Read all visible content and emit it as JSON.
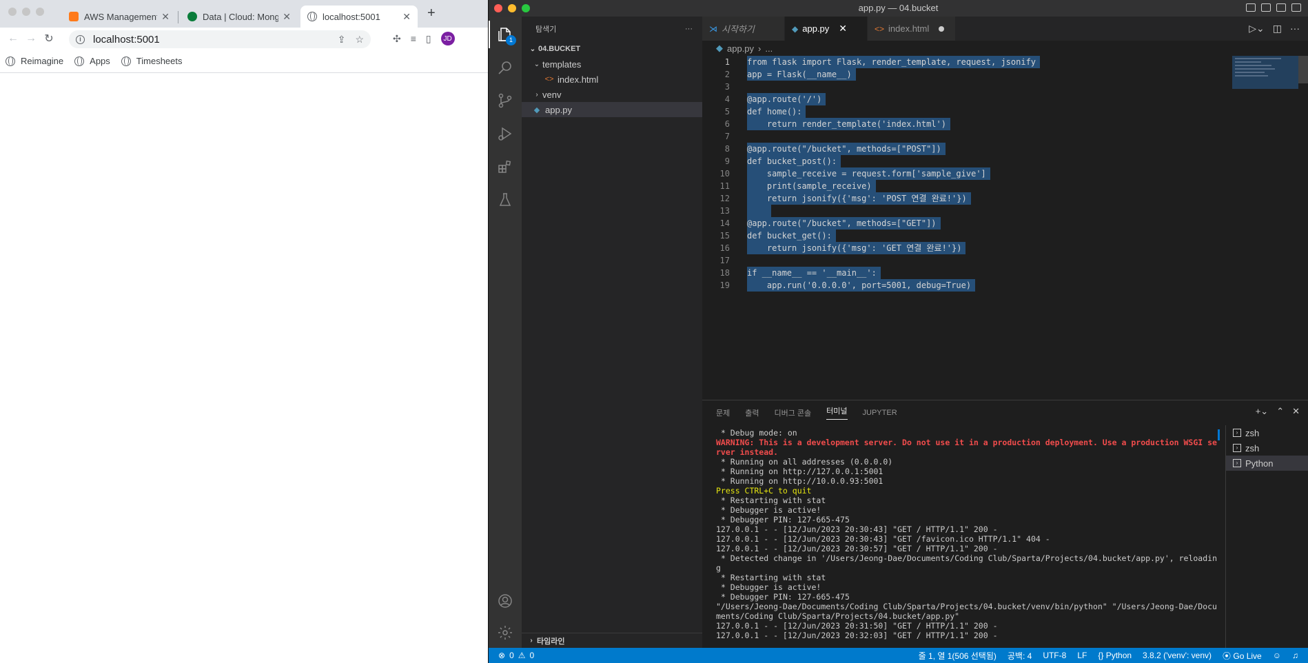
{
  "browser": {
    "tabs": [
      {
        "title": "AWS Management C",
        "favicon_color": "#ff7a1a"
      },
      {
        "title": "Data | Cloud: Mong",
        "favicon_color": "#0a7c3a"
      },
      {
        "title": "localhost:5001",
        "favicon_color": "#5f6368"
      }
    ],
    "new_tab": "+",
    "url": "localhost:5001",
    "bookmarks": [
      "Reimagine",
      "Apps",
      "Timesheets"
    ],
    "profile_initials": "JD"
  },
  "vscode": {
    "window_title": "app.py — 04.bucket",
    "explorer_title": "탐색기",
    "workspace": "04.BUCKET",
    "tree": {
      "templates": "templates",
      "index_html": "index.html",
      "venv": "venv",
      "app_py": "app.py"
    },
    "timeline": "타임라인",
    "explorer_badge": "1",
    "editor_tabs": [
      "시작하기",
      "app.py",
      "index.html"
    ],
    "breadcrumb": [
      "app.py",
      "..."
    ],
    "code_lines": [
      "from flask import Flask, render_template, request, jsonify",
      "app = Flask(__name__)",
      "",
      "@app.route('/')",
      "def home():",
      "    return render_template('index.html')",
      "",
      "@app.route(\"/bucket\", methods=[\"POST\"])",
      "def bucket_post():",
      "    sample_receive = request.form['sample_give']",
      "    print(sample_receive)",
      "    return jsonify({'msg': 'POST 연결 완료!'})",
      "    ",
      "@app.route(\"/bucket\", methods=[\"GET\"])",
      "def bucket_get():",
      "    return jsonify({'msg': 'GET 연결 완료!'})",
      "",
      "if __name__ == '__main__':",
      "    app.run('0.0.0.0', port=5001, debug=True)"
    ],
    "panel_tabs": [
      "문제",
      "출력",
      "디버그 콘솔",
      "터미널",
      "JUPYTER"
    ],
    "terminal_lines": [
      " * Debug mode: on",
      "WARNING: This is a development server. Do not use it in a production deployment. Use a production WSGI server instead.",
      " * Running on all addresses (0.0.0.0)",
      " * Running on http://127.0.0.1:5001",
      " * Running on http://10.0.0.93:5001",
      "Press CTRL+C to quit",
      " * Restarting with stat",
      " * Debugger is active!",
      " * Debugger PIN: 127-665-475",
      "127.0.0.1 - - [12/Jun/2023 20:30:43] \"GET / HTTP/1.1\" 200 -",
      "127.0.0.1 - - [12/Jun/2023 20:30:43] \"GET /favicon.ico HTTP/1.1\" 404 -",
      "127.0.0.1 - - [12/Jun/2023 20:30:57] \"GET / HTTP/1.1\" 200 -",
      " * Detected change in '/Users/Jeong-Dae/Documents/Coding Club/Sparta/Projects/04.bucket/app.py', reloading",
      " * Restarting with stat",
      " * Debugger is active!",
      " * Debugger PIN: 127-665-475",
      "\"/Users/Jeong-Dae/Documents/Coding Club/Sparta/Projects/04.bucket/venv/bin/python\" \"/Users/Jeong-Dae/Documents/Coding Club/Sparta/Projects/04.bucket/app.py\"",
      "127.0.0.1 - - [12/Jun/2023 20:31:50] \"GET / HTTP/1.1\" 200 -",
      "127.0.0.1 - - [12/Jun/2023 20:32:03] \"GET / HTTP/1.1\" 200 -"
    ],
    "terminals": [
      "zsh",
      "zsh",
      "Python"
    ],
    "status": {
      "errors": "0",
      "warnings": "0",
      "position": "줄 1, 열 1(506 선택됨)",
      "spaces": "공백: 4",
      "encoding": "UTF-8",
      "eol": "LF",
      "language": "Python",
      "interpreter": "3.8.2 ('venv': venv)",
      "golive": "Go Live"
    }
  },
  "colors": {
    "traffic_red": "#ff5f57",
    "traffic_yellow": "#febc2e",
    "traffic_green": "#28c840",
    "statusbar": "#007acc",
    "selection": "#264f78"
  }
}
